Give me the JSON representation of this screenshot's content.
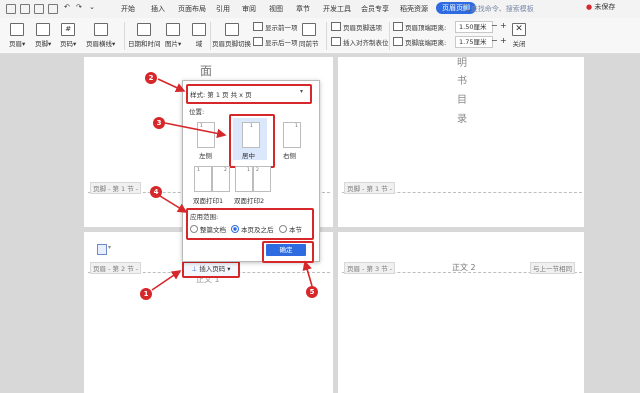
{
  "menubar": {
    "tabs": [
      "开始",
      "插入",
      "页面布局",
      "引用",
      "审阅",
      "视图",
      "章节",
      "开发工具",
      "会员专享",
      "稻壳资源",
      "页眉页脚"
    ],
    "active_tab": "页眉页脚",
    "search": "查找命令、搜索模板",
    "login": "未保存"
  },
  "ribbon": {
    "header": "页眉",
    "footer": "页脚",
    "page_number": "页码",
    "header_line": "页眉横线",
    "datetime": "日期和时间",
    "picture": "图片",
    "field": "域",
    "switch": "页眉页脚切换",
    "show_prev": "显示前一项",
    "show_next": "显示后一项",
    "same_as_prev": "同前节",
    "options": "页眉页脚选项",
    "insert_align_tab": "插入对齐制表位",
    "header_top_label": "页眉顶端距离:",
    "header_top_value": "1.50厘米",
    "footer_bottom_label": "页脚底端距离:",
    "footer_bottom_value": "1.75厘米",
    "close": "关闭"
  },
  "document": {
    "top_char": "面",
    "toc_chars": [
      "明",
      "书",
      "目",
      "录"
    ],
    "footer_tag_left": "页脚 - 第 1 节 -",
    "footer_tag_right": "页脚 - 第 1 节 -",
    "header_tag_left": "页眉 - 第 2 节 -",
    "header_tag_right": "页眉 - 第 3 节 -",
    "same_as_prev_tag": "与上一节相同",
    "body_left": "正文 1",
    "body_right": "正文 2",
    "insert_page_number_button": "插入页码"
  },
  "dialog": {
    "style_label": "样式:",
    "style_value": "第 1 页 共 x 页",
    "position_label": "位置:",
    "positions": [
      "左侧",
      "居中",
      "右侧",
      "双面打印1",
      "双面打印2"
    ],
    "selected_position": "居中",
    "scope_label": "应用范围:",
    "scope_options": [
      "整篇文档",
      "本页及之后",
      "本节"
    ],
    "selected_scope": "本页及之后",
    "ok_button": "确定"
  },
  "annotations": [
    "1",
    "2",
    "3",
    "4",
    "5"
  ],
  "colors": {
    "accent": "#2f6be0",
    "marker": "#d6282b"
  }
}
